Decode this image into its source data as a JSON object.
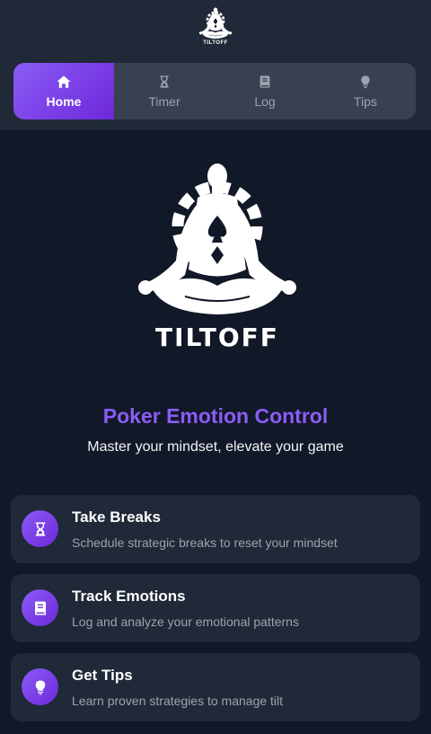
{
  "brand": {
    "name": "TILTOFF"
  },
  "tabs": [
    {
      "label": "Home",
      "icon": "home-icon",
      "active": true
    },
    {
      "label": "Timer",
      "icon": "hourglass-icon",
      "active": false
    },
    {
      "label": "Log",
      "icon": "book-icon",
      "active": false
    },
    {
      "label": "Tips",
      "icon": "lightbulb-icon",
      "active": false
    }
  ],
  "hero": {
    "title": "Poker Emotion Control",
    "subtitle": "Master your mindset, elevate your game"
  },
  "features": [
    {
      "title": "Take Breaks",
      "description": "Schedule strategic breaks to reset your mindset",
      "icon": "hourglass-icon"
    },
    {
      "title": "Track Emotions",
      "description": "Log and analyze your emotional patterns",
      "icon": "book-icon"
    },
    {
      "title": "Get Tips",
      "description": "Learn proven strategies to manage tilt",
      "icon": "lightbulb-icon"
    }
  ],
  "colors": {
    "accent": "#8b5cf6",
    "accent_dark": "#6d28d9",
    "background": "#111827",
    "surface": "#1f2937",
    "tab_bar": "#374151",
    "muted_text": "#9ca3af"
  }
}
